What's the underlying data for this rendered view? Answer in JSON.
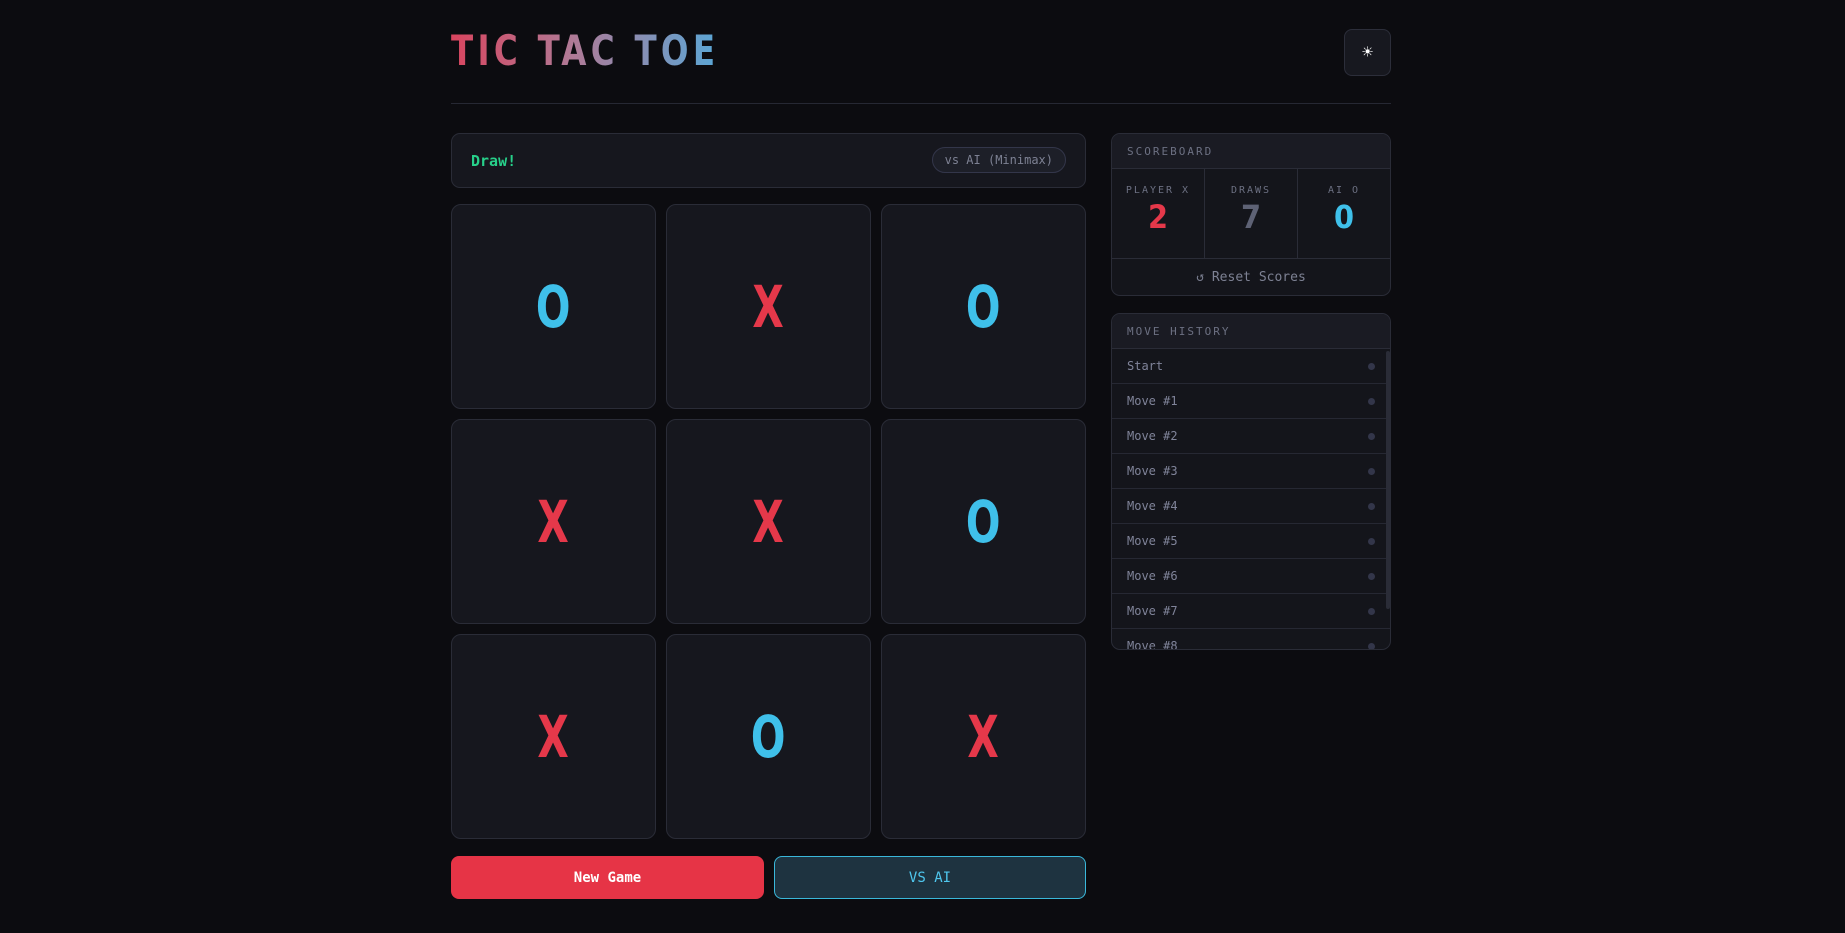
{
  "header": {
    "title": "TIC TAC TOE",
    "theme_icon": "sun-icon",
    "theme_glyph": "☀"
  },
  "status": {
    "text": "Draw!",
    "mode": "vs AI (Minimax)"
  },
  "board": {
    "cells": [
      "O",
      "X",
      "O",
      "X",
      "X",
      "O",
      "X",
      "O",
      "X"
    ]
  },
  "actions": {
    "new_game": "New Game",
    "vs_ai": "VS AI"
  },
  "scoreboard": {
    "title": "SCOREBOARD",
    "player_x_label": "PLAYER X",
    "player_x_score": "2",
    "draws_label": "DRAWS",
    "draws_score": "7",
    "ai_o_label": "AI O",
    "ai_o_score": "0",
    "reset_label": "↺ Reset Scores"
  },
  "history": {
    "title": "MOVE HISTORY",
    "items": [
      "Start",
      "Move #1",
      "Move #2",
      "Move #3",
      "Move #4",
      "Move #5",
      "Move #6",
      "Move #7",
      "Move #8"
    ]
  },
  "colors": {
    "x": "#e5384a",
    "o": "#3fc0ea",
    "draw_status": "#27d08a",
    "accent_red": "#e63446",
    "accent_cyan": "#3ab8da"
  }
}
